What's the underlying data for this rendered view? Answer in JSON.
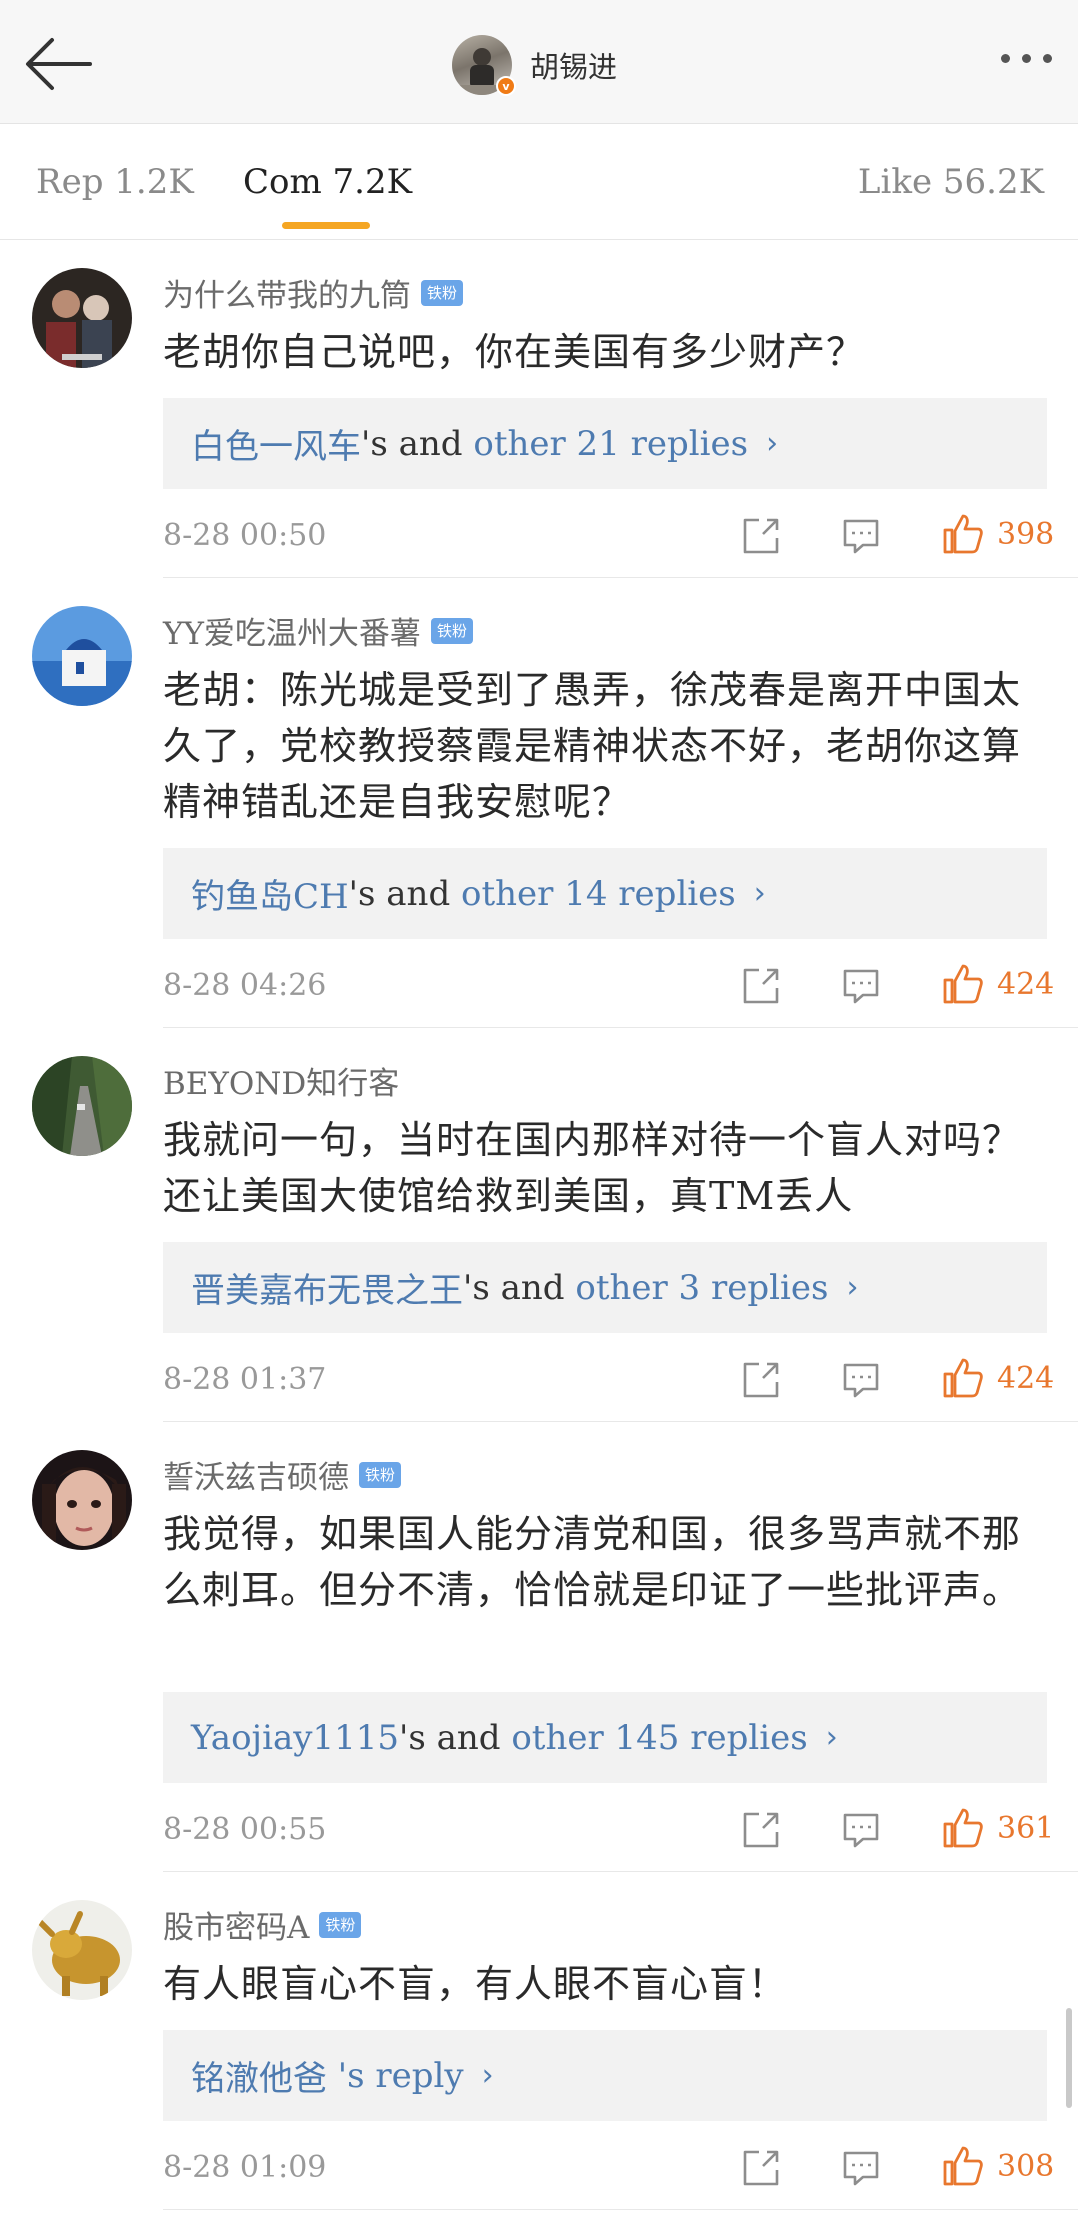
{
  "header": {
    "title": "胡锡进",
    "verified_badge": "v"
  },
  "tabs": [
    {
      "label": "Rep 1.2K"
    },
    {
      "label": "Com 7.2K"
    },
    {
      "label": "Like 56.2K"
    }
  ],
  "comments": [
    {
      "username": "为什么带我的九筒",
      "badge": "铁粉",
      "text": "老胡你自己说吧，你在美国有多少财产？",
      "reply_user": "白色一风车",
      "reply_mid": "'s and ",
      "reply_more": "other 21 replies",
      "time": "8-28 00:50",
      "likes": "398"
    },
    {
      "username": "YY爱吃温州大番薯",
      "badge": "铁粉",
      "text": "老胡：陈光城是受到了愚弄，徐茂春是离开中国太久了，党校教授蔡霞是精神状态不好，老胡你这算精神错乱还是自我安慰呢？",
      "reply_user": "钓鱼岛CH",
      "reply_mid": "'s and ",
      "reply_more": "other 14 replies",
      "time": "8-28 04:26",
      "likes": "424"
    },
    {
      "username": "BEYOND知行客",
      "badge": "",
      "text": "我就问一句，当时在国内那样对待一个盲人对吗？还让美国大使馆给救到美国，真TM丢人",
      "reply_user": "晋美嘉布无畏之王",
      "reply_mid": "'s and ",
      "reply_more": "other 3 replies",
      "time": "8-28 01:37",
      "likes": "424"
    },
    {
      "username": "誓沃兹吉硕德",
      "badge": "铁粉",
      "text": "我觉得，如果国人能分清党和国，很多骂声就不那么刺耳。但分不清，恰恰就是印证了一些批评声。",
      "reply_user": "Yaojiay1115",
      "reply_mid": "'s and ",
      "reply_more": "other 145 replies",
      "time": "8-28 00:55",
      "likes": "361"
    },
    {
      "username": "股市密码A",
      "badge": "铁粉",
      "text": "有人眼盲心不盲，有人眼不盲心盲！",
      "reply_user": "铭澈他爸",
      "reply_mid": " 's reply",
      "reply_more": "",
      "time": "8-28 01:09",
      "likes": "308"
    }
  ],
  "icons": {
    "back": "arrow-left-icon",
    "more": "more-dots-icon",
    "share": "share-icon",
    "comment": "comment-icon",
    "like": "thumbs-up-icon",
    "chevron": "chevron-right-icon"
  },
  "colors": {
    "tab_underline": "#f5a623",
    "like": "#e8772e",
    "link": "#4e7bb0",
    "fan_badge": "#6aa5e8"
  }
}
